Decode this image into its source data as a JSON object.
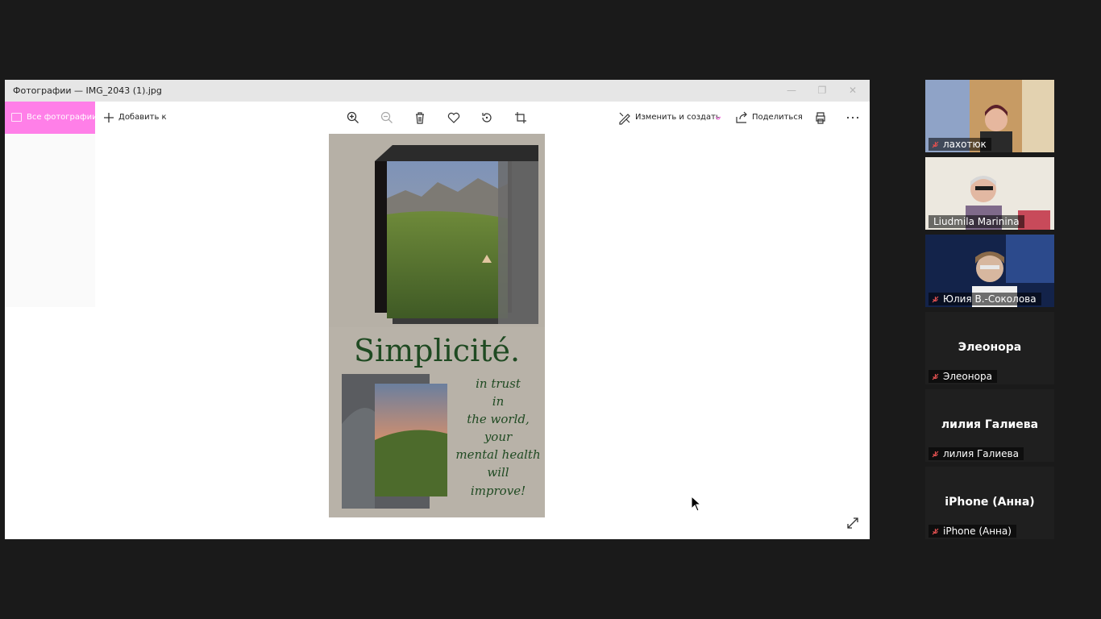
{
  "window": {
    "title": "Фотографии — IMG_2043 (1).jpg",
    "minimize_icon": "minimize-icon",
    "maximize_icon": "maximize-icon",
    "close_icon": "close-icon"
  },
  "toolbar": {
    "all_photos": "Все фотографии",
    "add_to": "Добавить к",
    "edit_create": "Изменить и создать",
    "share": "Поделиться",
    "accent_color": "#ff7fe8"
  },
  "photo": {
    "headline": "Simplicité.",
    "lines": [
      "in trust",
      "in",
      "the world,",
      "your",
      "mental health",
      "will",
      "improve!"
    ],
    "headline_color": "#1f4a22"
  },
  "participants": [
    {
      "name": "лахотюк",
      "muted": true,
      "video": true
    },
    {
      "name": "Liudmila Marinina",
      "muted": false,
      "video": true
    },
    {
      "name": "Юлия В.-Соколова",
      "muted": true,
      "video": true
    },
    {
      "name": "Элеонора",
      "muted": true,
      "video": false
    },
    {
      "name": "лилия Галиева",
      "muted": true,
      "video": false
    },
    {
      "name": "iPhone (Анна)",
      "muted": true,
      "video": false
    }
  ]
}
